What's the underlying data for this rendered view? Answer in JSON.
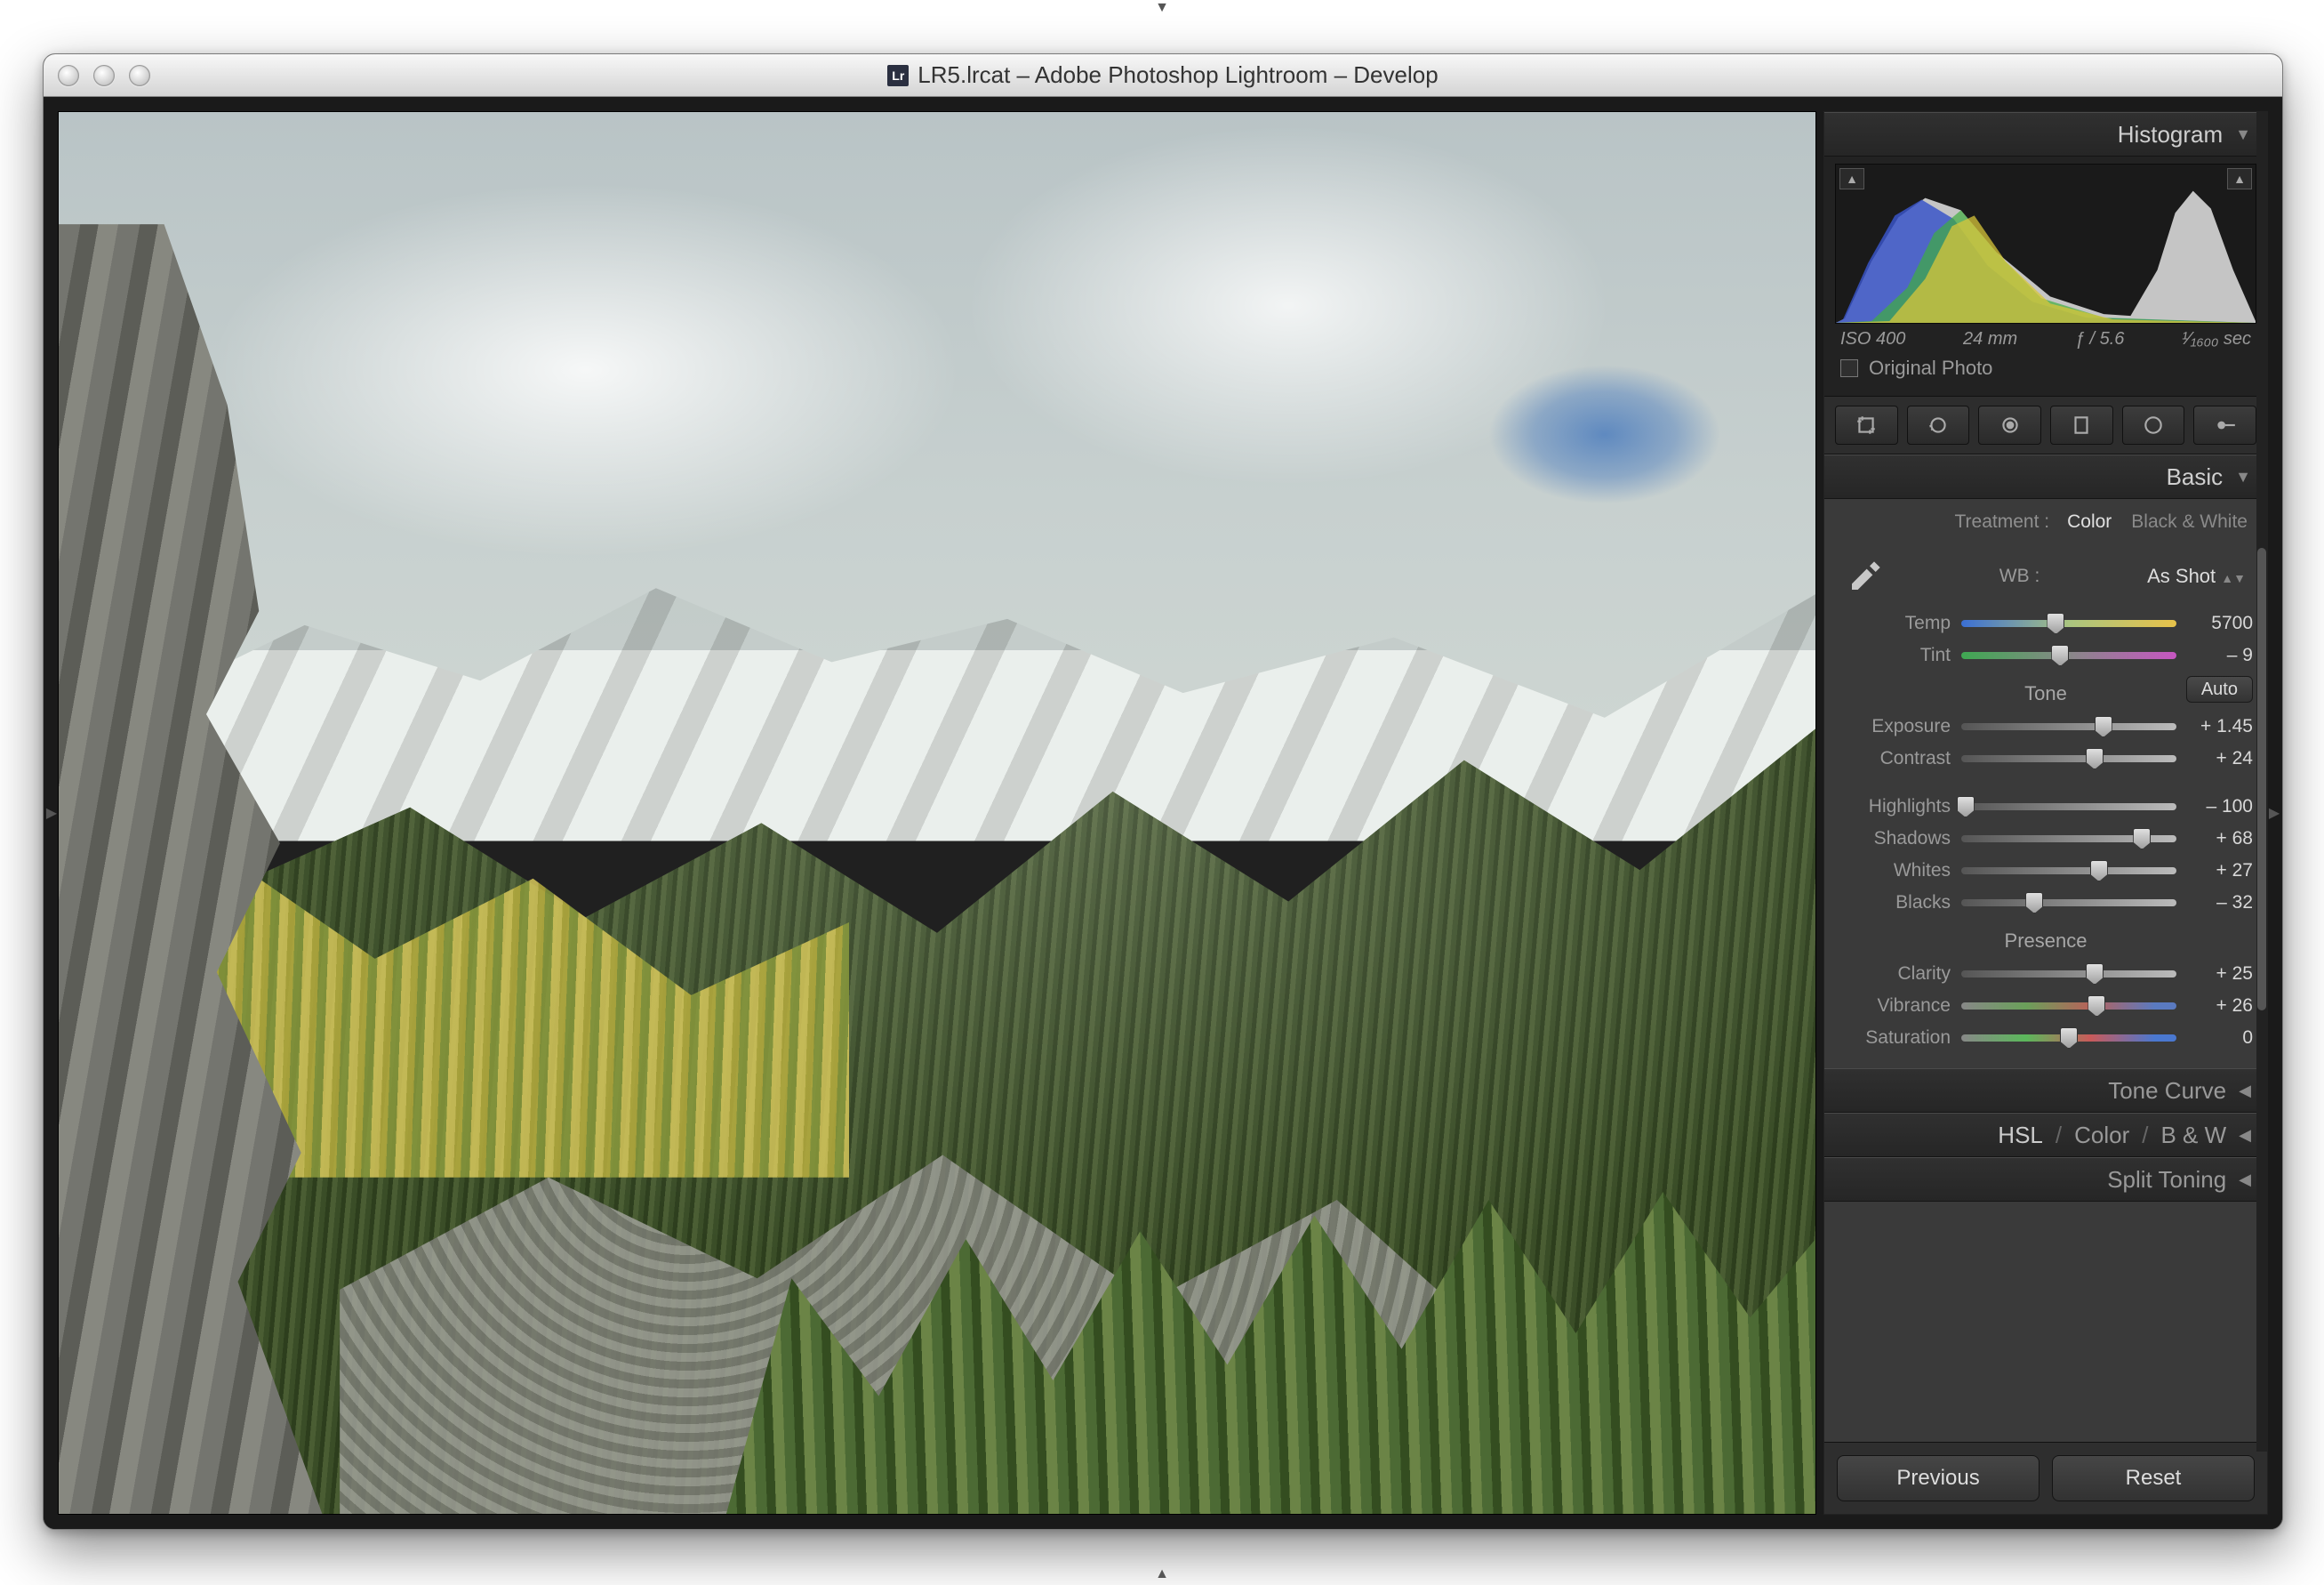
{
  "window": {
    "title": "LR5.lrcat – Adobe Photoshop Lightroom – Develop",
    "app_icon_text": "Lr"
  },
  "histogram": {
    "title": "Histogram",
    "iso": "ISO 400",
    "focal": "24 mm",
    "aperture": "ƒ / 5.6",
    "shutter": "¹⁄₁₆₀₀ sec",
    "original_label": "Original Photo"
  },
  "tools": {
    "crop": "crop-icon",
    "spot": "spot-removal-icon",
    "redeye": "redeye-icon",
    "grad": "graduated-filter-icon",
    "radial": "radial-filter-icon",
    "brush": "adjustment-brush-icon"
  },
  "basic": {
    "title": "Basic",
    "treatment_label": "Treatment :",
    "color": "Color",
    "bw": "Black & White",
    "wb_label": "WB :",
    "wb_value": "As Shot",
    "tone_label": "Tone",
    "auto": "Auto",
    "presence_label": "Presence",
    "sliders": {
      "temp": {
        "label": "Temp",
        "value": "5700",
        "pos": 44
      },
      "tint": {
        "label": "Tint",
        "value": "– 9",
        "pos": 46
      },
      "exposure": {
        "label": "Exposure",
        "value": "+ 1.45",
        "pos": 66
      },
      "contrast": {
        "label": "Contrast",
        "value": "+ 24",
        "pos": 62
      },
      "highlights": {
        "label": "Highlights",
        "value": "– 100",
        "pos": 2
      },
      "shadows": {
        "label": "Shadows",
        "value": "+ 68",
        "pos": 84
      },
      "whites": {
        "label": "Whites",
        "value": "+ 27",
        "pos": 64
      },
      "blacks": {
        "label": "Blacks",
        "value": "– 32",
        "pos": 34
      },
      "clarity": {
        "label": "Clarity",
        "value": "+ 25",
        "pos": 62
      },
      "vibrance": {
        "label": "Vibrance",
        "value": "+ 26",
        "pos": 63
      },
      "saturation": {
        "label": "Saturation",
        "value": "0",
        "pos": 50
      }
    }
  },
  "panels": {
    "tone_curve": "Tone Curve",
    "hsl": "HSL",
    "color": "Color",
    "bw": "B & W",
    "split_toning": "Split Toning"
  },
  "footer": {
    "previous": "Previous",
    "reset": "Reset"
  }
}
